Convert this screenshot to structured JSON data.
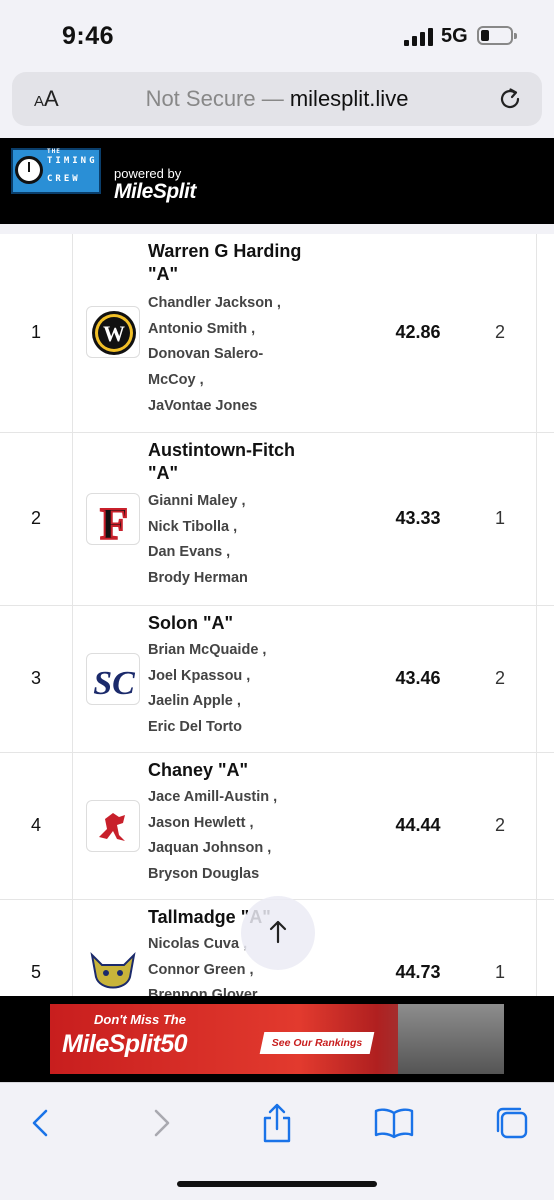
{
  "status_bar": {
    "time": "9:46",
    "network": "5G"
  },
  "browser": {
    "text_size_label": "AA",
    "url_prefix": "Not Secure — ",
    "url_host": "milesplit.live"
  },
  "header": {
    "logo_top": "TIMING",
    "logo_bottom": "CREW",
    "logo_the": "THE",
    "powered_by": "powered by",
    "brand": "MileSplit"
  },
  "results": [
    {
      "place": "1",
      "team": "Warren G Harding \"A\"",
      "athletes": [
        "Chandler Jackson ,",
        "Antonio Smith ,",
        "Donovan Salero-",
        "McCoy ,",
        "JaVontae Jones"
      ],
      "time": "42.86",
      "heat": "2"
    },
    {
      "place": "2",
      "team": "Austintown-Fitch \"A\"",
      "athletes": [
        "Gianni Maley ,",
        "Nick Tibolla ,",
        "Dan Evans ,",
        "Brody Herman"
      ],
      "time": "43.33",
      "heat": "1"
    },
    {
      "place": "3",
      "team": "Solon \"A\"",
      "athletes": [
        "Brian McQuaide ,",
        "Joel Kpassou ,",
        "Jaelin Apple ,",
        "Eric Del Torto"
      ],
      "time": "43.46",
      "heat": "2"
    },
    {
      "place": "4",
      "team": "Chaney \"A\"",
      "athletes": [
        "Jace Amill-Austin ,",
        "Jason Hewlett ,",
        "Jaquan Johnson ,",
        "Bryson Douglas"
      ],
      "time": "44.44",
      "heat": "2"
    },
    {
      "place": "5",
      "team": "Tallmadge \"A\"",
      "athletes": [
        "Nicolas Cuva ,",
        "Connor Green ,",
        "Brennon Glover"
      ],
      "time": "44.73",
      "heat": "1"
    }
  ],
  "ad": {
    "line1": "Don't Miss The",
    "line2": "MileSplit50",
    "cta": "See Our Rankings"
  },
  "colors": {
    "header_bg": "#000000",
    "ad_red": "#c81e1e",
    "ios_blue": "#1a73e8"
  }
}
